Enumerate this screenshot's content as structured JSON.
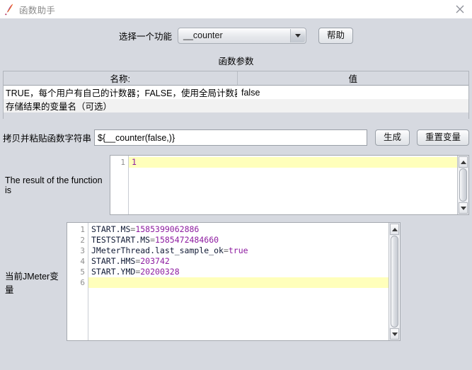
{
  "window": {
    "title": "函数助手",
    "icon": "jmeter-feather-icon",
    "close_label": "×"
  },
  "toolbar": {
    "select_label": "选择一个功能",
    "selected_function": "__counter",
    "dropdown_icon": "chevron-down-icon",
    "help_label": "帮助"
  },
  "params": {
    "section_title": "函数参数",
    "columns": [
      "名称:",
      "值"
    ],
    "rows": [
      {
        "name": "TRUE，每个用户有自己的计数器；FALSE，使用全局计数器",
        "value": "false"
      },
      {
        "name": "存储结果的变量名（可选）",
        "value": ""
      }
    ]
  },
  "function_string": {
    "label": "拷贝并粘贴函数字符串",
    "value": "${__counter(false,)}",
    "placeholder": "",
    "generate_label": "生成",
    "reset_label": "重置变量"
  },
  "result": {
    "label": "The result of the function is",
    "lines": [
      {
        "no": "1",
        "key": "1",
        "eq": "",
        "val": "",
        "highlight": true
      }
    ],
    "gutter_numbers": [
      "1"
    ],
    "scroll_up_icon": "triangle-up-icon",
    "scroll_down_icon": "triangle-down-icon"
  },
  "variables": {
    "label": "当前JMeter变量",
    "gutter_numbers": [
      "1",
      "2",
      "3",
      "4",
      "5",
      "6"
    ],
    "lines": [
      {
        "no": "1",
        "key": "START.MS",
        "eq": "=",
        "val": "1585399062886",
        "highlight": false
      },
      {
        "no": "2",
        "key": "TESTSTART.MS",
        "eq": "=",
        "val": "1585472484660",
        "highlight": false
      },
      {
        "no": "3",
        "key": "JMeterThread.last_sample_ok",
        "eq": "=",
        "val": "true",
        "highlight": false
      },
      {
        "no": "4",
        "key": "START.HMS",
        "eq": "=",
        "val": "203742",
        "highlight": false
      },
      {
        "no": "5",
        "key": "START.YMD",
        "eq": "=",
        "val": "20200328",
        "highlight": false
      },
      {
        "no": "6",
        "key": "",
        "eq": "",
        "val": "",
        "highlight": true
      }
    ],
    "scroll_up_icon": "triangle-up-icon",
    "scroll_down_icon": "triangle-down-icon"
  },
  "colors": {
    "window_background": "#d6d9e0",
    "titlebar_background": "#ffffff",
    "highlight_line": "#ffffbb",
    "value_token": "#8d1ba0",
    "key_token": "#101a35",
    "title_text": "#8a8a8a"
  }
}
